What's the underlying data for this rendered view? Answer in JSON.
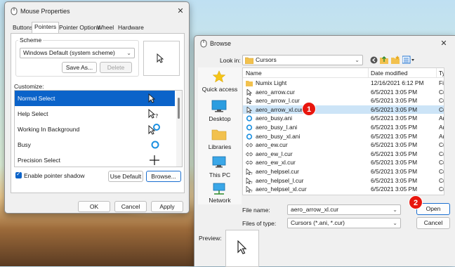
{
  "mouse_properties": {
    "title": "Mouse Properties",
    "tabs": [
      "Buttons",
      "Pointers",
      "Pointer Options",
      "Wheel",
      "Hardware"
    ],
    "active_tab": "Pointers",
    "scheme_label": "Scheme",
    "scheme_value": "Windows Default (system scheme)",
    "save_as_label": "Save As...",
    "delete_label": "Delete",
    "customize_label": "Customize:",
    "cursors": [
      {
        "label": "Normal Select",
        "icon": "arrow-cursor-icon"
      },
      {
        "label": "Help Select",
        "icon": "help-cursor-icon"
      },
      {
        "label": "Working In Background",
        "icon": "working-cursor-icon"
      },
      {
        "label": "Busy",
        "icon": "busy-cursor-icon"
      },
      {
        "label": "Precision Select",
        "icon": "crosshair-cursor-icon"
      }
    ],
    "shadow_label": "Enable pointer shadow",
    "shadow_checked": true,
    "use_default_label": "Use Default",
    "browse_label": "Browse...",
    "ok_label": "OK",
    "cancel_label": "Cancel",
    "apply_label": "Apply"
  },
  "browse": {
    "title": "Browse",
    "look_in_label": "Look in:",
    "look_in_value": "Cursors",
    "places": [
      "Quick access",
      "Desktop",
      "Libraries",
      "This PC",
      "Network"
    ],
    "columns": {
      "name": "Name",
      "date": "Date modified",
      "type": "Ty"
    },
    "files": [
      {
        "name": "Numix Light",
        "date": "12/16/2021 6:12 PM",
        "type": "Fi",
        "icon": "folder-icon"
      },
      {
        "name": "aero_arrow.cur",
        "date": "6/5/2021 3:05 PM",
        "type": "Cu",
        "icon": "arrow-cursor-icon"
      },
      {
        "name": "aero_arrow_l.cur",
        "date": "6/5/2021 3:05 PM",
        "type": "Cu",
        "icon": "arrow-cursor-icon"
      },
      {
        "name": "aero_arrow_xl.cur",
        "date": "6/5/2021 3:05 PM",
        "type": "Cu",
        "icon": "arrow-cursor-icon"
      },
      {
        "name": "aero_busy.ani",
        "date": "6/5/2021 3:05 PM",
        "type": "An",
        "icon": "busy-cursor-icon"
      },
      {
        "name": "aero_busy_l.ani",
        "date": "6/5/2021 3:05 PM",
        "type": "An",
        "icon": "busy-cursor-icon"
      },
      {
        "name": "aero_busy_xl.ani",
        "date": "6/5/2021 3:05 PM",
        "type": "An",
        "icon": "busy-cursor-icon"
      },
      {
        "name": "aero_ew.cur",
        "date": "6/5/2021 3:05 PM",
        "type": "Cu",
        "icon": "resize-ew-icon"
      },
      {
        "name": "aero_ew_l.cur",
        "date": "6/5/2021 3:05 PM",
        "type": "Cu",
        "icon": "resize-ew-icon"
      },
      {
        "name": "aero_ew_xl.cur",
        "date": "6/5/2021 3:05 PM",
        "type": "Cu",
        "icon": "resize-ew-icon"
      },
      {
        "name": "aero_helpsel.cur",
        "date": "6/5/2021 3:05 PM",
        "type": "Cu",
        "icon": "help-cursor-icon"
      },
      {
        "name": "aero_helpsel_l.cur",
        "date": "6/5/2021 3:05 PM",
        "type": "Cu",
        "icon": "help-cursor-icon"
      },
      {
        "name": "aero_helpsel_xl.cur",
        "date": "6/5/2021 3:05 PM",
        "type": "Cu",
        "icon": "help-cursor-icon"
      }
    ],
    "selected_file": "aero_arrow_xl.cur",
    "file_name_label": "File name:",
    "file_name_value": "aero_arrow_xl.cur",
    "files_of_type_label": "Files of type:",
    "files_of_type_value": "Cursors (*.ani, *.cur)",
    "open_label": "Open",
    "cancel_label": "Cancel",
    "preview_label": "Preview:"
  },
  "annotations": {
    "badge1": "1",
    "badge2": "2"
  },
  "colors": {
    "selection": "#0b63c9",
    "row_highlight": "#cce4f7",
    "badge": "#e8160e",
    "accent": "#1a6fd0"
  }
}
